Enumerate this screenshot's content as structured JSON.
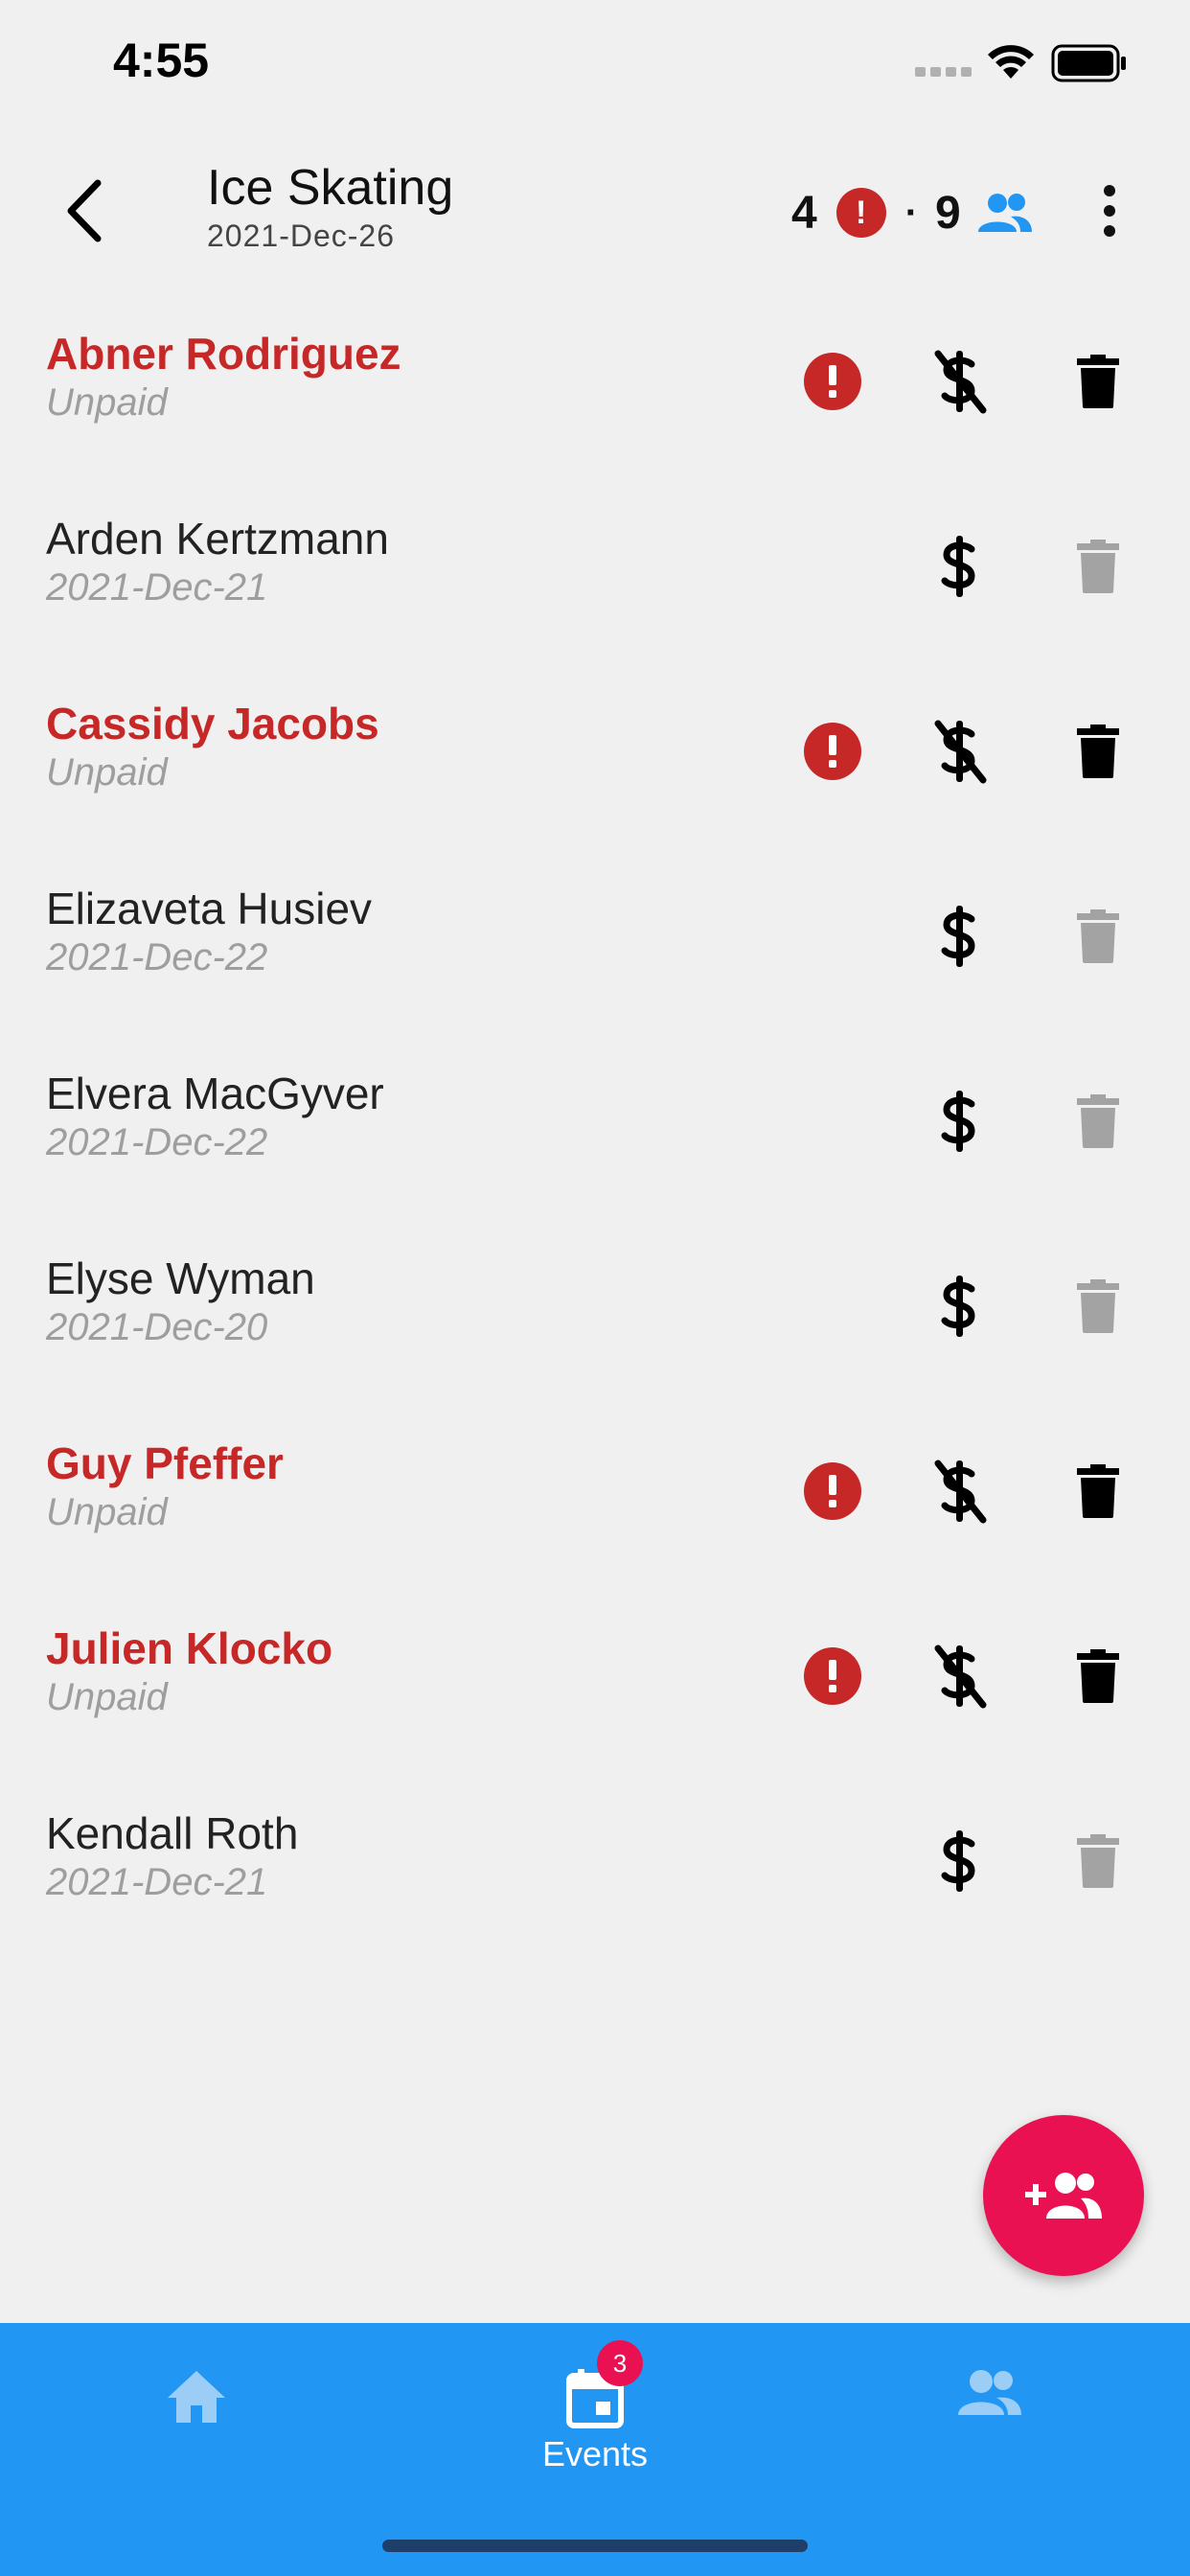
{
  "status": {
    "time": "4:55"
  },
  "header": {
    "title": "Ice Skating",
    "date": "2021-Dec-26",
    "unpaid_count": "4",
    "alert_glyph": "!",
    "separator": "·",
    "attendee_count": "9",
    "icons": {
      "back": "chevron-left-icon",
      "alert": "alert-icon",
      "people": "people-icon",
      "more": "more-vert-icon"
    }
  },
  "attendees": [
    {
      "name": "Abner Rodriguez",
      "detail": "Unpaid",
      "paid": false
    },
    {
      "name": "Arden Kertzmann",
      "detail": "2021-Dec-21",
      "paid": true
    },
    {
      "name": "Cassidy Jacobs",
      "detail": "Unpaid",
      "paid": false
    },
    {
      "name": "Elizaveta Husiev",
      "detail": "2021-Dec-22",
      "paid": true
    },
    {
      "name": "Elvera MacGyver",
      "detail": "2021-Dec-22",
      "paid": true
    },
    {
      "name": "Elyse Wyman",
      "detail": "2021-Dec-20",
      "paid": true
    },
    {
      "name": "Guy Pfeffer",
      "detail": "Unpaid",
      "paid": false
    },
    {
      "name": "Julien Klocko",
      "detail": "Unpaid",
      "paid": false
    },
    {
      "name": "Kendall Roth",
      "detail": "2021-Dec-21",
      "paid": true
    }
  ],
  "fab": {
    "icon": "add-group-icon"
  },
  "nav": {
    "events_label": "Events",
    "events_badge": "3",
    "icons": {
      "home": "home-icon",
      "events": "calendar-icon",
      "people": "people-icon"
    }
  },
  "colors": {
    "accent": "#2196f3",
    "unpaid": "#c62828",
    "fab": "#e91152",
    "background": "#f0f0f0",
    "muted": "#9e9e9e"
  }
}
